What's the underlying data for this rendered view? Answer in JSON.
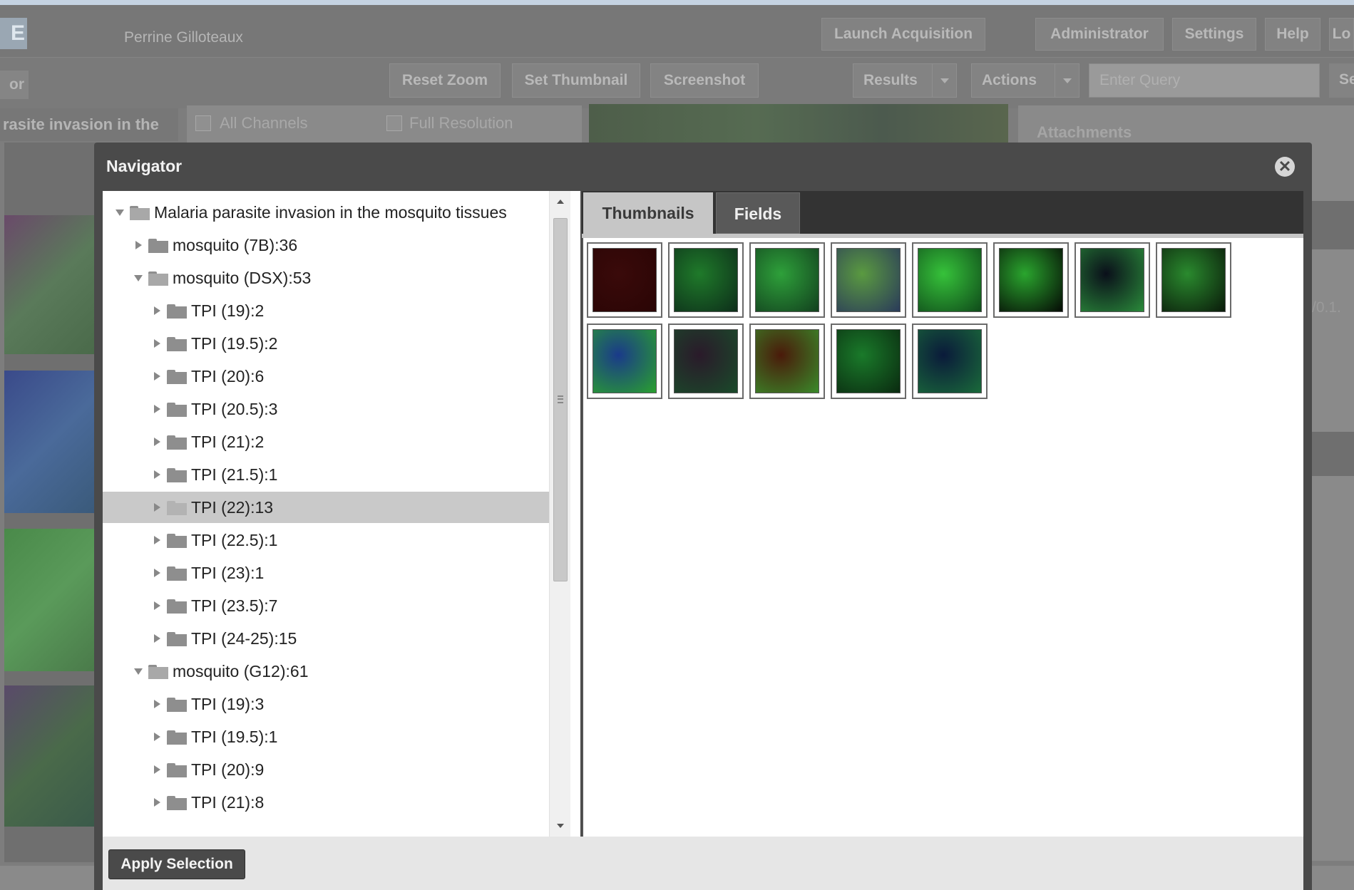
{
  "header": {
    "logo_text": "E",
    "user_name": "Perrine Gilloteaux",
    "buttons": [
      "Launch Acquisition",
      "Administrator",
      "Settings",
      "Help",
      "Lo"
    ]
  },
  "toolbar": {
    "left_label": "or",
    "buttons": [
      "Reset Zoom",
      "Set Thumbnail",
      "Screenshot"
    ],
    "results_label": "Results",
    "actions_label": "Actions",
    "query_placeholder": "Enter Query",
    "right_label": "Se"
  },
  "background": {
    "title": "rasite invasion in the",
    "all_channels": "All Channels",
    "full_resolution": "Full Resolution",
    "attachments": "Attachments",
    "version_text": "/0.1."
  },
  "navigator": {
    "title": "Navigator",
    "close_icon": "close-icon",
    "tree": [
      {
        "label": "Malaria parasite invasion in the mosquito tissues",
        "level": 0,
        "expanded": true,
        "selected": false
      },
      {
        "label": "mosquito (7B):36",
        "level": 1,
        "expanded": false,
        "selected": false
      },
      {
        "label": "mosquito (DSX):53",
        "level": 1,
        "expanded": true,
        "selected": false
      },
      {
        "label": "TPI (19):2",
        "level": 2,
        "expanded": false,
        "selected": false
      },
      {
        "label": "TPI (19.5):2",
        "level": 2,
        "expanded": false,
        "selected": false
      },
      {
        "label": "TPI (20):6",
        "level": 2,
        "expanded": false,
        "selected": false
      },
      {
        "label": "TPI (20.5):3",
        "level": 2,
        "expanded": false,
        "selected": false
      },
      {
        "label": "TPI (21):2",
        "level": 2,
        "expanded": false,
        "selected": false
      },
      {
        "label": "TPI (21.5):1",
        "level": 2,
        "expanded": false,
        "selected": false
      },
      {
        "label": "TPI (22):13",
        "level": 2,
        "expanded": false,
        "selected": true
      },
      {
        "label": "TPI (22.5):1",
        "level": 2,
        "expanded": false,
        "selected": false
      },
      {
        "label": "TPI (23):1",
        "level": 2,
        "expanded": false,
        "selected": false
      },
      {
        "label": "TPI (23.5):7",
        "level": 2,
        "expanded": false,
        "selected": false
      },
      {
        "label": "TPI (24-25):15",
        "level": 2,
        "expanded": false,
        "selected": false
      },
      {
        "label": "mosquito (G12):61",
        "level": 1,
        "expanded": true,
        "selected": false
      },
      {
        "label": "TPI (19):3",
        "level": 2,
        "expanded": false,
        "selected": false
      },
      {
        "label": "TPI (19.5):1",
        "level": 2,
        "expanded": false,
        "selected": false
      },
      {
        "label": "TPI (20):9",
        "level": 2,
        "expanded": false,
        "selected": false
      },
      {
        "label": "TPI (21):8",
        "level": 2,
        "expanded": false,
        "selected": false
      }
    ],
    "tabs": [
      {
        "label": "Thumbnails",
        "active": true
      },
      {
        "label": "Fields",
        "active": false
      }
    ],
    "thumbnails": [
      {
        "colors": [
          "#3a0a0a",
          "#2a0505"
        ]
      },
      {
        "colors": [
          "#1f7a2a",
          "#0d2e1a"
        ]
      },
      {
        "colors": [
          "#2ea03a",
          "#12401e"
        ]
      },
      {
        "colors": [
          "#5a9a40",
          "#2a3a5a"
        ]
      },
      {
        "colors": [
          "#36c23a",
          "#0f4a1a"
        ]
      },
      {
        "colors": [
          "#2aa52e",
          "#050a05"
        ]
      },
      {
        "colors": [
          "#0a0f1a",
          "#2a8a3a"
        ]
      },
      {
        "colors": [
          "#2a8a2e",
          "#0a1a0a"
        ]
      },
      {
        "colors": [
          "#1a3a8a",
          "#2aa02e"
        ]
      },
      {
        "colors": [
          "#2a1a2a",
          "#1a4a2a"
        ]
      },
      {
        "colors": [
          "#4a1a0a",
          "#3a8a2a"
        ]
      },
      {
        "colors": [
          "#1a7a2a",
          "#0a2a10"
        ]
      },
      {
        "colors": [
          "#0a1a3a",
          "#1a6a3a"
        ]
      }
    ],
    "apply_label": "Apply Selection"
  }
}
